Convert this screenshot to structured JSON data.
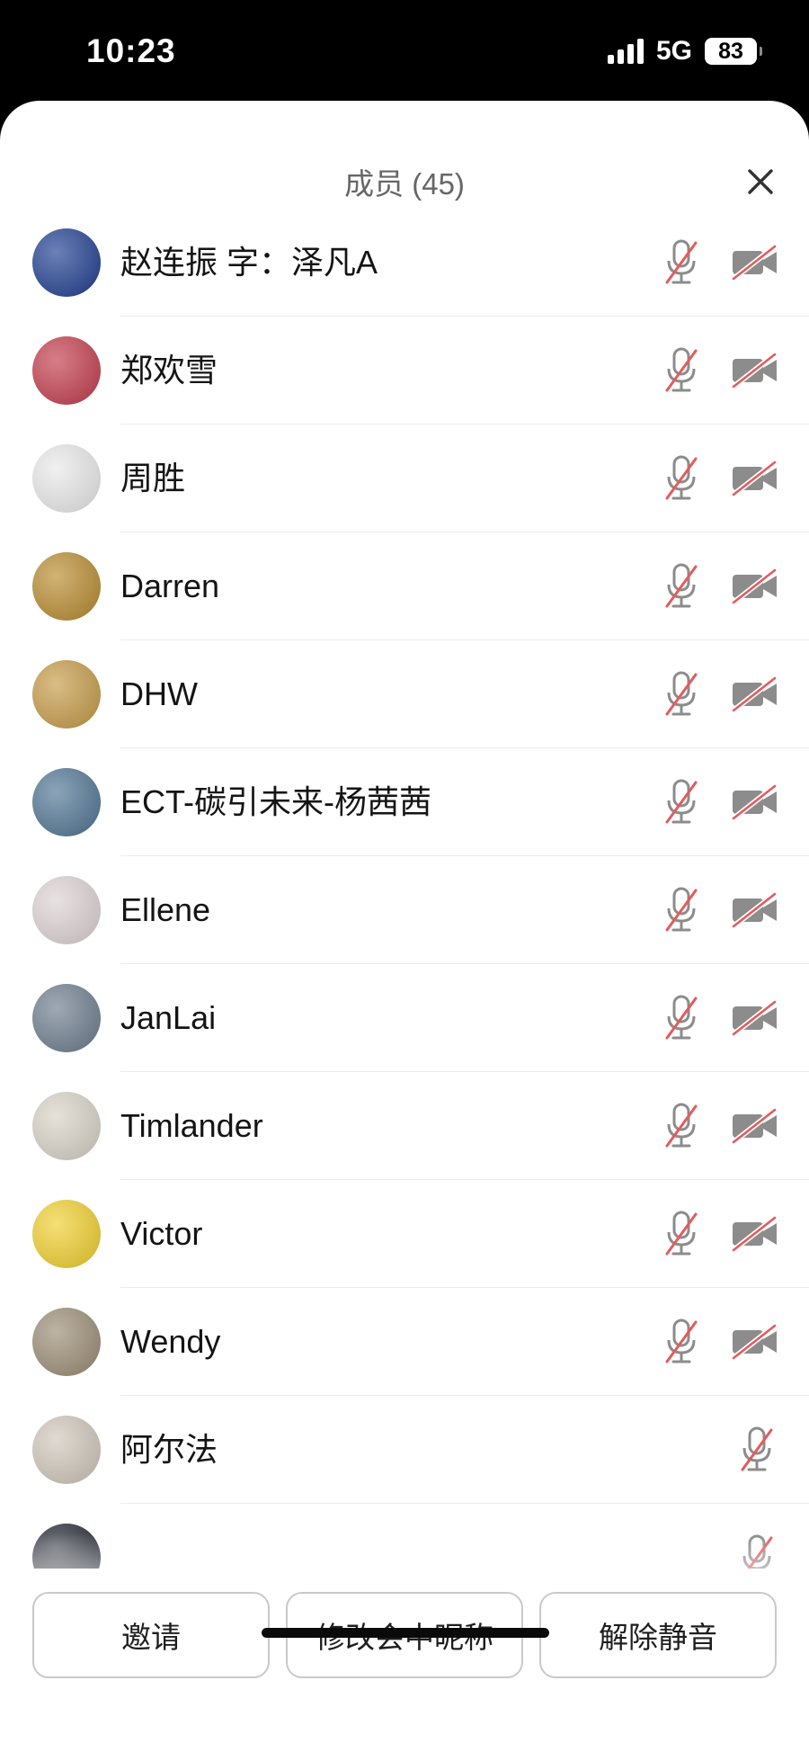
{
  "status": {
    "time": "10:23",
    "network": "5G",
    "battery": "83"
  },
  "header": {
    "title": "成员 (45)",
    "close_icon": "close-icon"
  },
  "members": [
    {
      "name": "赵连振   字：泽凡A",
      "mic": "mic-muted",
      "camera": "camera-off",
      "avatar_color": "#1d3c8f"
    },
    {
      "name": "郑欢雪",
      "mic": "mic-muted",
      "camera": "camera-off",
      "avatar_color": "#c23a4a"
    },
    {
      "name": "周胜",
      "mic": "mic-muted",
      "camera": "camera-off",
      "avatar_color": "#e9e9e9"
    },
    {
      "name": "Darren",
      "mic": "mic-muted",
      "camera": "camera-off",
      "avatar_color": "#b88a2c"
    },
    {
      "name": "DHW",
      "mic": "mic-muted",
      "camera": "camera-off",
      "avatar_color": "#c59a45"
    },
    {
      "name": "ECT-碳引未来-杨茜茜",
      "mic": "mic-muted",
      "camera": "camera-off",
      "avatar_color": "#4d7392"
    },
    {
      "name": "Ellene",
      "mic": "mic-muted",
      "camera": "camera-off",
      "avatar_color": "#ddd2d3"
    },
    {
      "name": "JanLai",
      "mic": "mic-muted",
      "camera": "camera-off",
      "avatar_color": "#6b7b8c"
    },
    {
      "name": "Timlander",
      "mic": "mic-muted",
      "camera": "camera-off",
      "avatar_color": "#d8d2c6"
    },
    {
      "name": "Victor",
      "mic": "mic-muted",
      "camera": "camera-off",
      "avatar_color": "#f0cf2c"
    },
    {
      "name": "Wendy",
      "mic": "mic-muted",
      "camera": "camera-off",
      "avatar_color": "#9a8b73"
    },
    {
      "name": "阿尔法",
      "mic": "mic-muted",
      "camera": "",
      "avatar_color": "#cfc6ba"
    },
    {
      "name": "",
      "mic": "mic-muted",
      "camera": "",
      "avatar_color": "#1f2430"
    }
  ],
  "footer": {
    "invite": "邀请",
    "rename": "修改会中昵称",
    "unmute": "解除静音"
  },
  "colors": {
    "muted_slash": "#e45b5b",
    "icon_gray": "#8c8c8c"
  }
}
